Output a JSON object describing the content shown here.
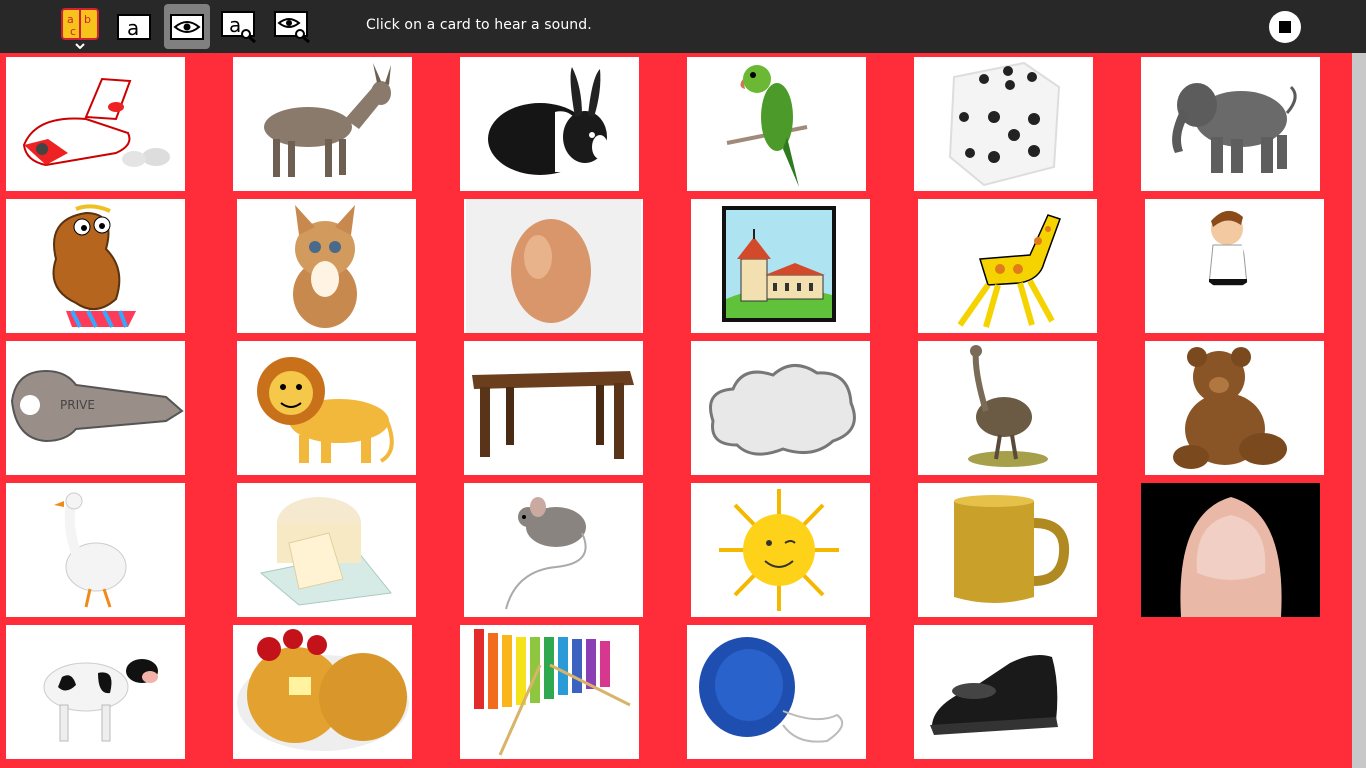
{
  "toolbar": {
    "hint": "Click on a card to hear a sound.",
    "logo_letters": [
      "a",
      "b",
      "c"
    ],
    "letter_glyph": "a"
  },
  "colors": {
    "background": "#ff2d3a",
    "toolbar": "#282828",
    "active_button": "#808080"
  },
  "cards": [
    {
      "name": "airplane"
    },
    {
      "name": "donkey"
    },
    {
      "name": "rabbit"
    },
    {
      "name": "parrot"
    },
    {
      "name": "dice"
    },
    {
      "name": "elephant"
    },
    {
      "name": "seal"
    },
    {
      "name": "kitten"
    },
    {
      "name": "egg"
    },
    {
      "name": "church"
    },
    {
      "name": "giraffe"
    },
    {
      "name": "karate"
    },
    {
      "name": "key",
      "text": "PRIVE"
    },
    {
      "name": "lion"
    },
    {
      "name": "table"
    },
    {
      "name": "cloud"
    },
    {
      "name": "ostrich"
    },
    {
      "name": "teddy-bear"
    },
    {
      "name": "goose"
    },
    {
      "name": "cheese"
    },
    {
      "name": "mouse"
    },
    {
      "name": "sun"
    },
    {
      "name": "mug"
    },
    {
      "name": "fingernail"
    },
    {
      "name": "cow"
    },
    {
      "name": "waffles"
    },
    {
      "name": "xylophone"
    },
    {
      "name": "yoyo"
    },
    {
      "name": "shoe"
    }
  ]
}
